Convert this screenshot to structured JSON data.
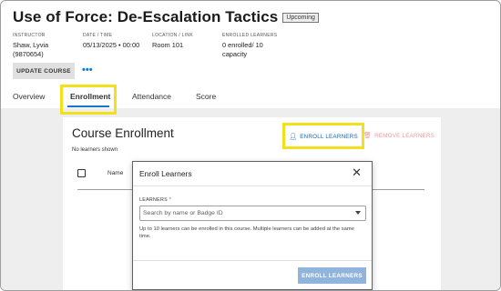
{
  "course": {
    "title": "Use of Force: De-Escalation Tactics",
    "status": "Upcoming"
  },
  "info": {
    "instructor_label": "INSTRUCTOR",
    "instructor_name": "Shaw, Lyvia",
    "instructor_id": "(9870654)",
    "date_label": "DATE / TIME",
    "date_value": "05/13/2025 • 00:00",
    "location_label": "LOCATION / LINK",
    "location_value": "Room 101",
    "enrolled_label": "ENROLLED LEARNERS",
    "enrolled_value": "0 enrolled/ 10",
    "enrolled_capacity": "capacity"
  },
  "actions": {
    "update_course": "UPDATE COURSE",
    "more": "•••"
  },
  "tabs": [
    {
      "label": "Overview"
    },
    {
      "label": "Enrollment",
      "active": true
    },
    {
      "label": "Attendance"
    },
    {
      "label": "Score"
    }
  ],
  "enrollment": {
    "title": "Course Enrollment",
    "empty_text": "No learners shown",
    "column_name": "Name",
    "enroll_button": "ENROLL LEARNERS",
    "remove_button": "REMOVE LEARNERS"
  },
  "dialog": {
    "title": "Enroll Learners",
    "field_label": "LEARNERS",
    "required_mark": "*",
    "placeholder": "Search by name or Badge ID",
    "helper_text": "Up to 10 learners can be enrolled in this course. Multiple learners can be added at the same time.",
    "submit": "ENROLL LEARNERS"
  },
  "icons": {
    "close": "close-icon",
    "dropdown": "chevron-down-icon",
    "person": "person-icon",
    "trash": "trash-icon",
    "more": "more-horizontal-icon"
  },
  "colors": {
    "accent": "#1976d2",
    "highlight": "#f2e01a",
    "danger_disabled": "#ef9a9a",
    "primary_disabled": "#90b4dc"
  }
}
